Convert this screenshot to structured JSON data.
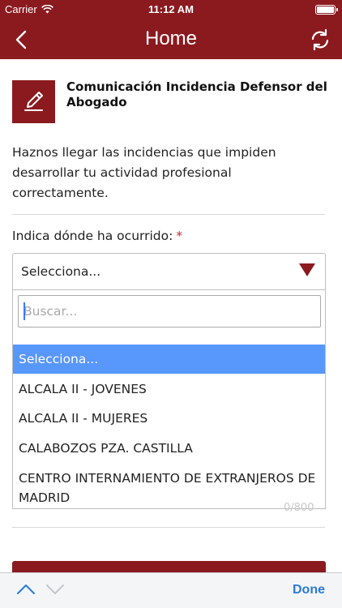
{
  "status_bar": {
    "carrier": "Carrier",
    "time": "11:12 AM"
  },
  "nav": {
    "title": "Home",
    "back_icon": "chevron-left-icon",
    "refresh_icon": "refresh-icon"
  },
  "form": {
    "icon": "edit-pencil-icon",
    "title": "Comunicación Incidencia Defensor del Abogado",
    "intro": "Haznos llegar las incidencias que impiden desarrollar tu actividad profesional correctamente.",
    "location_label": "Indica dónde ha ocurrido:",
    "required_mark": "*",
    "select_value": "Selecciona...",
    "search_placeholder": "Buscar...",
    "options": [
      "Selecciona...",
      "ALCALA II - JOVENES",
      "ALCALA II - MUJERES",
      "CALABOZOS PZA. CASTILLA",
      "CENTRO INTERNAMIENTO DE EXTRANJEROS DE MADRID"
    ],
    "char_counter": "0/800"
  },
  "keyboard_toolbar": {
    "done_label": "Done"
  },
  "colors": {
    "brand": "#8b1a1f",
    "selected_option": "#5897fb",
    "link": "#2a7bd6"
  }
}
